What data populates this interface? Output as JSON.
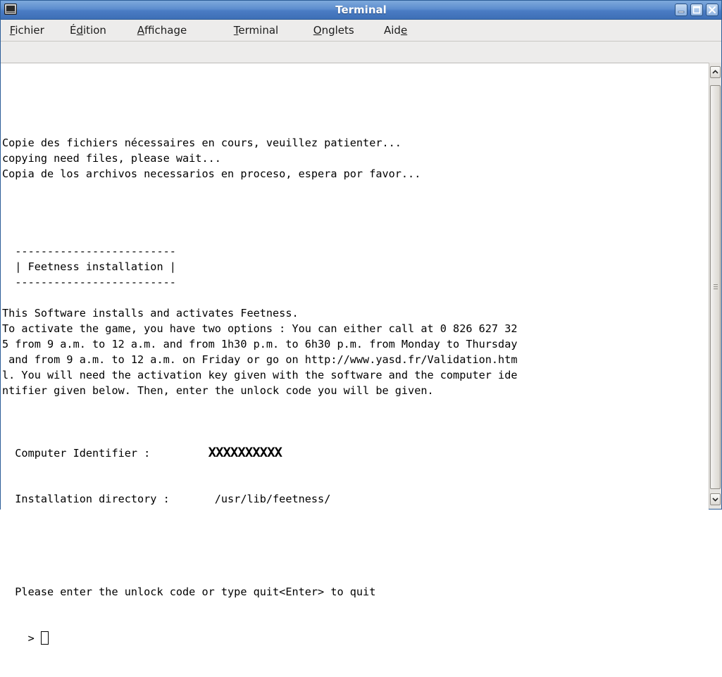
{
  "window": {
    "title": "Terminal"
  },
  "menu": [
    {
      "pre": "",
      "ul": "F",
      "post": "ichier"
    },
    {
      "pre": "É",
      "ul": "d",
      "post": "ition"
    },
    {
      "pre": "",
      "ul": "A",
      "post": "ffichage"
    },
    {
      "pre": "",
      "ul": "T",
      "post": "erminal"
    },
    {
      "pre": "",
      "ul": "O",
      "post": "nglets"
    },
    {
      "pre": "Aid",
      "ul": "e",
      "post": ""
    }
  ],
  "terminal": {
    "lines": [
      "Copie des fichiers nécessaires en cours, veuillez patienter...",
      "copying need files, please wait...",
      "Copia de los archivos necessarios en proceso, espera por favor...",
      "",
      "",
      "",
      "",
      "  -------------------------",
      "  | Feetness installation |",
      "  -------------------------",
      "",
      "This Software installs and activates Feetness.",
      "To activate the game, you have two options : You can either call at 0 826 627 32",
      "5 from 9 a.m. to 12 a.m. and from 1h30 p.m. to 6h30 p.m. from Monday to Thursday",
      " and from 9 a.m. to 12 a.m. on Friday or go on http://www.yasd.fr/Validation.htm",
      "l. You will need the activation key given with the software and the computer ide",
      "ntifier given below. Then, enter the unlock code you will be given.",
      ""
    ],
    "identifier_label": "  Computer Identifier :         ",
    "identifier_value": "XXXXXXXXXX",
    "directory_label": "  Installation directory :       ",
    "directory_value": "/usr/lib/feetness/",
    "prompt_text": "  Please enter the unlock code or type quit<Enter> to quit",
    "prompt_symbol": "    > "
  },
  "colors": {
    "titlebar": "#4a7cc4",
    "terminal_bg": "#ffffff",
    "terminal_fg": "#000000"
  },
  "icons": {
    "app": "terminal-icon",
    "minimize": "minimize-icon",
    "maximize": "maximize-icon",
    "close": "close-icon",
    "scroll_up": "arrow-up-icon",
    "scroll_down": "arrow-down-icon"
  }
}
